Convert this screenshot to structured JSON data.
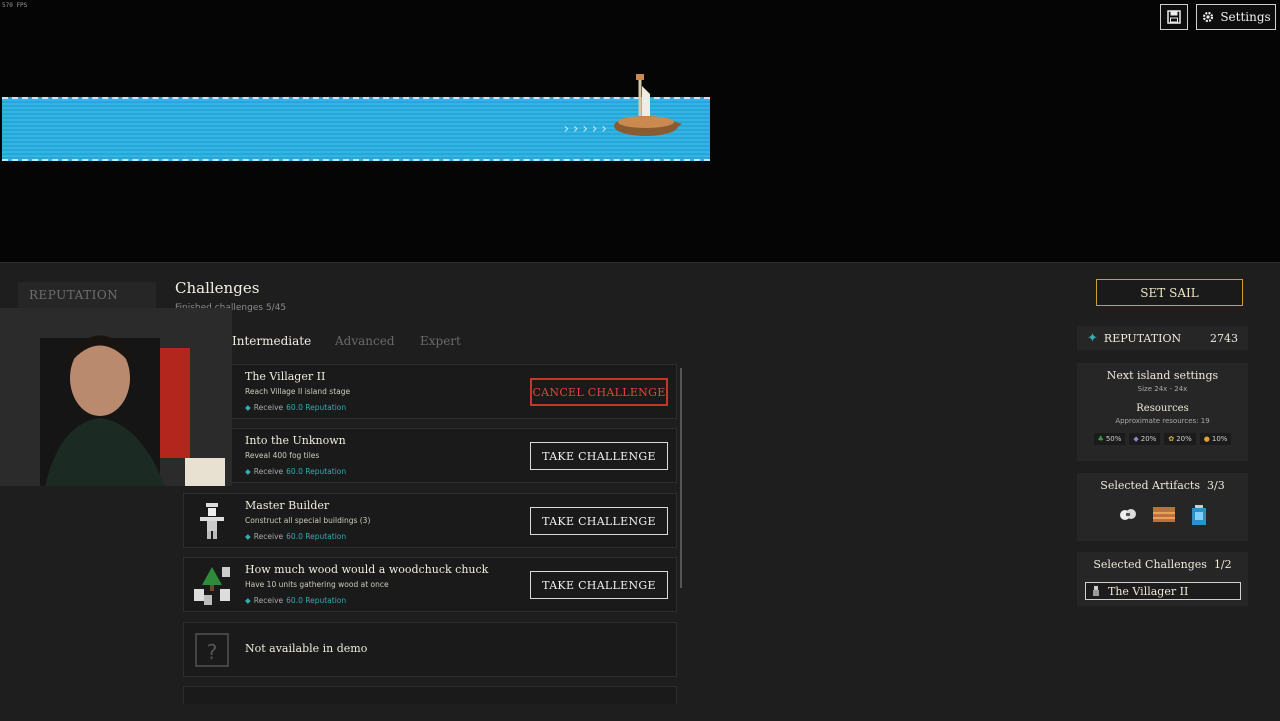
{
  "fps": "570 FPS",
  "topbar": {
    "settings_label": "Settings"
  },
  "left_tab": {
    "label": "REPUTATION"
  },
  "challenges": {
    "title": "Challenges",
    "finished": "Finished challenges 5/45",
    "tabs": [
      "Intermediate",
      "Advanced",
      "Expert"
    ],
    "active_tab": "Intermediate",
    "items": [
      {
        "name": "The Villager II",
        "desc": "Reach Village II island stage",
        "reward_prefix": "Receive",
        "reward_amount": "60.0 Reputation",
        "button": "CANCEL CHALLENGE",
        "state": "active"
      },
      {
        "name": "Into the Unknown",
        "desc": "Reveal 400 fog tiles",
        "reward_prefix": "Receive",
        "reward_amount": "60.0 Reputation",
        "button": "TAKE CHALLENGE",
        "state": "available"
      },
      {
        "name": "Master Builder",
        "desc": "Construct all special buildings (3)",
        "reward_prefix": "Receive",
        "reward_amount": "60.0 Reputation",
        "button": "TAKE CHALLENGE",
        "state": "available"
      },
      {
        "name": "How much wood would a woodchuck chuck",
        "desc": "Have 10 units gathering wood at once",
        "reward_prefix": "Receive",
        "reward_amount": "60.0 Reputation",
        "button": "TAKE CHALLENGE",
        "state": "available"
      },
      {
        "name": "Not available in demo",
        "state": "locked"
      }
    ]
  },
  "right": {
    "set_sail": "SET SAIL",
    "reputation_label": "REPUTATION",
    "reputation_value": "2743",
    "island": {
      "title": "Next island settings",
      "size": "Size 24x - 24x",
      "resources_title": "Resources",
      "approx": "Approximate resources: 19",
      "resources": [
        "50%",
        "20%",
        "20%",
        "10%"
      ]
    },
    "artifacts": {
      "title": "Selected Artifacts",
      "count": "3/3"
    },
    "selected_challenges": {
      "title": "Selected Challenges",
      "count": "1/2",
      "item": "The Villager II"
    }
  },
  "colors": {
    "water": "#31b5e4",
    "accent_gold": "#c9a227",
    "cancel_red": "#c0392b",
    "reward_teal": "#36a9b0"
  }
}
